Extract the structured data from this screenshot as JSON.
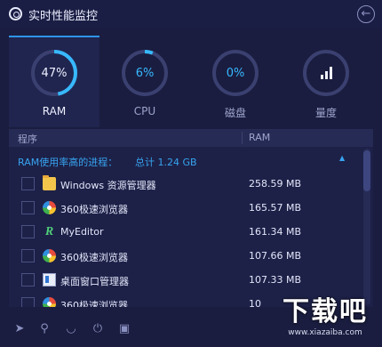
{
  "window": {
    "title": "实时性能监控",
    "back_icon": "back-arrow-icon",
    "logo_icon": "app-logo-icon"
  },
  "tabs": [
    {
      "label": "RAM",
      "value": "47%",
      "percent": 47,
      "active": true,
      "icon": "ram-ring"
    },
    {
      "label": "CPU",
      "value": "6%",
      "percent": 6,
      "active": false,
      "icon": "cpu-ring"
    },
    {
      "label": "磁盘",
      "value": "0%",
      "percent": 0,
      "active": false,
      "icon": "disk-ring"
    },
    {
      "label": "量度",
      "value": "",
      "active": false,
      "icon": "bar-chart-icon"
    }
  ],
  "table": {
    "headers": {
      "name": "程序",
      "ram": "RAM"
    },
    "group": {
      "title": "RAM使用率高的进程：",
      "total": "总计 1.24 GB",
      "collapse_icon": "collapse-up-icon"
    },
    "rows": [
      {
        "name": "Windows 资源管理器",
        "ram": "258.59 MB",
        "icon": "folder-icon"
      },
      {
        "name": "360极速浏览器",
        "ram": "165.57 MB",
        "icon": "browser-icon"
      },
      {
        "name": "MyEditor",
        "ram": "161.34 MB",
        "icon": "editor-icon"
      },
      {
        "name": "360极速浏览器",
        "ram": "107.66 MB",
        "icon": "browser-icon"
      },
      {
        "name": "桌面窗口管理器",
        "ram": "107.33 MB",
        "icon": "desktop-window-icon"
      },
      {
        "name": "360极速浏览器",
        "ram": "10",
        "icon": "browser-icon"
      }
    ]
  },
  "toolbar": {
    "items": [
      "rocket-icon",
      "search-icon",
      "speed-icon",
      "power-icon",
      "crop-icon"
    ]
  },
  "watermark": {
    "text": "下载吧",
    "url": "www.xiazaiba.com"
  },
  "colors": {
    "accent": "#37b8ff",
    "background": "#1a1d3f",
    "ring_track": "#3a4070"
  }
}
